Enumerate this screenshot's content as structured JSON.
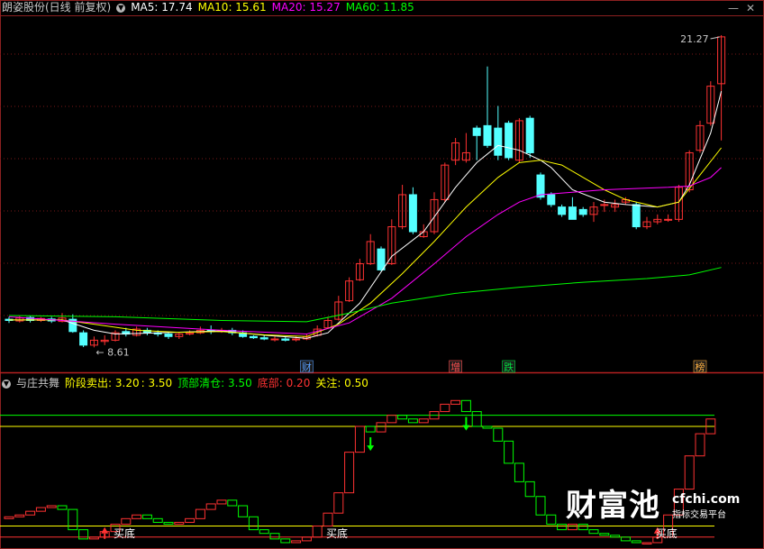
{
  "main_header": {
    "stock_name": "朗姿股份(日线 前复权)",
    "ma5": "MA5: 17.74",
    "ma10": "MA10: 15.61",
    "ma20": "MA20: 15.27",
    "ma60": "MA60: 11.85",
    "colors": {
      "name": "#c8c8c8",
      "ma5": "#ffffff",
      "ma10": "#ffff00",
      "ma20": "#ff00ff",
      "ma60": "#00ff00"
    }
  },
  "sub_header": {
    "indicator_name": "与庄共舞",
    "stage_sell": "阶段卖出: 3.20",
    "stage_sell2": ": 3.50",
    "top_clear": "顶部清仓: 3.50",
    "bottom": "底部: 0.20",
    "attention": "关注: 0.50",
    "colors": {
      "stage": "#ffff00",
      "top": "#00ff00",
      "bottom": "#ff3232",
      "attention": "#ffff00"
    }
  },
  "controls": {
    "toggle_icon": "chevron-down-icon",
    "window_minimize_icon": "minus-icon",
    "window_close_icon": "close-icon"
  },
  "chart_data": [
    {
      "type": "candlestick",
      "title": "朗姿股份(日线 前复权)",
      "price_annotations": {
        "high": "21.27",
        "low": "8.61"
      },
      "event_tags": [
        {
          "index": 28,
          "text": "财",
          "color": "#5aa0ff"
        },
        {
          "index": 42,
          "text": "增",
          "color": "#ff5050"
        },
        {
          "index": 47,
          "text": "跌",
          "color": "#00e040"
        },
        {
          "index": 65,
          "text": "榜",
          "color": "#ffb040"
        }
      ],
      "series": [
        {
          "name": "MA5",
          "color": "#ffffff"
        },
        {
          "name": "MA10",
          "color": "#ffff00"
        },
        {
          "name": "MA20",
          "color": "#ff00ff"
        },
        {
          "name": "MA60",
          "color": "#00ff00"
        }
      ],
      "ylim": [
        8.0,
        22.0
      ],
      "candles": [
        [
          9.75,
          9.7,
          9.85,
          9.6
        ],
        [
          9.68,
          9.8,
          9.88,
          9.62
        ],
        [
          9.82,
          9.7,
          9.9,
          9.62
        ],
        [
          9.7,
          9.78,
          9.84,
          9.64
        ],
        [
          9.76,
          9.68,
          9.85,
          9.6
        ],
        [
          9.66,
          9.8,
          10.0,
          9.62
        ],
        [
          9.75,
          9.25,
          9.95,
          9.2
        ],
        [
          9.2,
          8.7,
          9.3,
          8.62
        ],
        [
          8.7,
          8.9,
          9.05,
          8.61
        ],
        [
          8.85,
          8.9,
          9.1,
          8.7
        ],
        [
          8.9,
          9.2,
          9.3,
          8.85
        ],
        [
          9.25,
          9.15,
          9.4,
          9.05
        ],
        [
          9.1,
          9.35,
          9.45,
          9.05
        ],
        [
          9.3,
          9.2,
          9.4,
          9.1
        ],
        [
          9.2,
          9.15,
          9.3,
          9.05
        ],
        [
          9.15,
          9.05,
          9.25,
          8.95
        ],
        [
          9.05,
          9.15,
          9.2,
          8.95
        ],
        [
          9.15,
          9.2,
          9.3,
          9.1
        ],
        [
          9.2,
          9.3,
          9.45,
          9.15
        ],
        [
          9.3,
          9.25,
          9.5,
          9.15
        ],
        [
          9.25,
          9.3,
          9.4,
          9.2
        ],
        [
          9.3,
          9.2,
          9.4,
          9.1
        ],
        [
          9.2,
          9.05,
          9.3,
          9.0
        ],
        [
          9.05,
          9.0,
          9.1,
          8.95
        ],
        [
          9.0,
          8.95,
          9.1,
          8.9
        ],
        [
          8.95,
          8.95,
          9.05,
          8.85
        ],
        [
          8.95,
          8.9,
          9.05,
          8.85
        ],
        [
          8.95,
          8.95,
          9.05,
          8.85
        ],
        [
          8.95,
          9.05,
          9.15,
          8.9
        ],
        [
          9.1,
          9.35,
          9.5,
          9.05
        ],
        [
          9.4,
          9.7,
          9.85,
          9.35
        ],
        [
          9.75,
          10.45,
          10.7,
          9.7
        ],
        [
          10.5,
          11.3,
          11.45,
          10.45
        ],
        [
          11.35,
          12.0,
          12.2,
          11.3
        ],
        [
          12.0,
          12.9,
          13.2,
          11.95
        ],
        [
          12.6,
          11.75,
          12.7,
          11.7
        ],
        [
          12.0,
          13.5,
          13.8,
          11.95
        ],
        [
          13.5,
          14.8,
          15.2,
          13.4
        ],
        [
          14.8,
          13.3,
          15.1,
          13.2
        ],
        [
          13.1,
          13.3,
          13.6,
          13.05
        ],
        [
          13.3,
          14.6,
          14.9,
          13.2
        ],
        [
          14.6,
          16.0,
          16.1,
          14.5
        ],
        [
          16.2,
          16.9,
          17.1,
          16.0
        ],
        [
          16.2,
          16.5,
          17.3,
          16.1
        ],
        [
          17.5,
          17.2,
          17.6,
          16.2
        ],
        [
          17.6,
          16.8,
          20.0,
          16.7
        ],
        [
          17.5,
          16.4,
          18.4,
          16.2
        ],
        [
          17.7,
          16.3,
          17.8,
          16.2
        ],
        [
          16.2,
          17.8,
          17.9,
          16.1
        ],
        [
          17.9,
          16.5,
          18.0,
          16.3
        ],
        [
          15.6,
          14.7,
          15.7,
          14.6
        ],
        [
          14.8,
          14.4,
          14.9,
          14.3
        ],
        [
          14.3,
          14.0,
          14.4,
          13.9
        ],
        [
          14.3,
          13.8,
          14.7,
          13.8
        ],
        [
          14.2,
          14.0,
          14.3,
          13.9
        ],
        [
          14.0,
          14.3,
          14.5,
          13.7
        ],
        [
          14.4,
          14.4,
          14.6,
          14.1
        ],
        [
          14.3,
          14.4,
          14.6,
          14.1
        ],
        [
          14.5,
          14.6,
          14.7,
          14.4
        ],
        [
          14.4,
          13.5,
          14.5,
          13.4
        ],
        [
          13.5,
          13.7,
          13.9,
          13.4
        ],
        [
          13.7,
          13.8,
          14.0,
          13.6
        ],
        [
          13.8,
          13.8,
          14.0,
          13.7
        ],
        [
          13.8,
          15.1,
          15.2,
          13.7
        ],
        [
          15.0,
          16.5,
          16.6,
          14.9
        ],
        [
          16.6,
          17.6,
          17.8,
          16.5
        ],
        [
          17.7,
          19.2,
          19.4,
          17.6
        ],
        [
          19.3,
          21.2,
          21.27,
          17.0
        ]
      ],
      "ma": {
        "MA5": [
          [
            0,
            9.72
          ],
          [
            5,
            9.72
          ],
          [
            8,
            9.3
          ],
          [
            10,
            9.15
          ],
          [
            14,
            9.2
          ],
          [
            20,
            9.28
          ],
          [
            24,
            9.1
          ],
          [
            28,
            8.98
          ],
          [
            30,
            9.2
          ],
          [
            33,
            10.4
          ],
          [
            36,
            12.3
          ],
          [
            39,
            13.3
          ],
          [
            42,
            15.1
          ],
          [
            44,
            16.1
          ],
          [
            46,
            16.8
          ],
          [
            48,
            16.6
          ],
          [
            50,
            16.2
          ],
          [
            51,
            15.9
          ],
          [
            53,
            15.0
          ],
          [
            56,
            14.5
          ],
          [
            58,
            14.4
          ],
          [
            61,
            14.3
          ],
          [
            63,
            14.5
          ],
          [
            64,
            15.2
          ],
          [
            66,
            17.3
          ],
          [
            67,
            19.0
          ]
        ],
        "MA10": [
          [
            0,
            9.72
          ],
          [
            5,
            9.72
          ],
          [
            8,
            9.55
          ],
          [
            12,
            9.3
          ],
          [
            16,
            9.22
          ],
          [
            20,
            9.25
          ],
          [
            24,
            9.12
          ],
          [
            28,
            9.05
          ],
          [
            31,
            9.55
          ],
          [
            34,
            10.4
          ],
          [
            37,
            11.6
          ],
          [
            40,
            12.9
          ],
          [
            43,
            14.3
          ],
          [
            46,
            15.5
          ],
          [
            48,
            16.1
          ],
          [
            50,
            16.2
          ],
          [
            52,
            16.0
          ],
          [
            54,
            15.5
          ],
          [
            56,
            15.0
          ],
          [
            58,
            14.6
          ],
          [
            61,
            14.3
          ],
          [
            63,
            14.5
          ],
          [
            65,
            15.6
          ],
          [
            67,
            16.7
          ]
        ],
        "MA20": [
          [
            0,
            9.85
          ],
          [
            10,
            9.55
          ],
          [
            20,
            9.3
          ],
          [
            28,
            9.15
          ],
          [
            32,
            9.6
          ],
          [
            36,
            10.6
          ],
          [
            40,
            12.0
          ],
          [
            43,
            13.1
          ],
          [
            46,
            14.0
          ],
          [
            48,
            14.5
          ],
          [
            50,
            14.8
          ],
          [
            53,
            14.9
          ],
          [
            56,
            15.0
          ],
          [
            59,
            15.05
          ],
          [
            62,
            15.1
          ],
          [
            64,
            15.15
          ],
          [
            66,
            15.5
          ],
          [
            67,
            15.9
          ]
        ],
        "MA60": [
          [
            0,
            9.9
          ],
          [
            10,
            9.85
          ],
          [
            20,
            9.7
          ],
          [
            28,
            9.65
          ],
          [
            32,
            10.0
          ],
          [
            36,
            10.4
          ],
          [
            42,
            10.8
          ],
          [
            48,
            11.05
          ],
          [
            54,
            11.25
          ],
          [
            60,
            11.4
          ],
          [
            64,
            11.55
          ],
          [
            67,
            11.85
          ]
        ]
      }
    },
    {
      "type": "bar",
      "title": "与庄共舞",
      "ylim": [
        0.0,
        4.2
      ],
      "reference_lines": [
        {
          "name": "阶段卖出",
          "value": 3.2,
          "color": "#ffff00"
        },
        {
          "name": "顶部清仓",
          "value": 3.5,
          "color": "#00ff00"
        },
        {
          "name": "关注",
          "value": 0.5,
          "color": "#ffff00"
        },
        {
          "name": "底部",
          "value": 0.2,
          "color": "#ff3232"
        }
      ],
      "labels": [
        {
          "index": 10,
          "text": "买底"
        },
        {
          "index": 30,
          "text": "买底"
        },
        {
          "index": 61,
          "text": "买底"
        }
      ],
      "down_arrows": [
        34,
        43
      ],
      "up_arrows": [
        9,
        61
      ],
      "step_bars": [
        [
          0.7,
          0.75
        ],
        [
          0.75,
          0.8
        ],
        [
          0.8,
          0.9
        ],
        [
          0.9,
          1.0
        ],
        [
          1.0,
          1.05
        ],
        [
          1.05,
          0.95
        ],
        [
          0.95,
          0.4
        ],
        [
          0.4,
          0.15
        ],
        [
          0.15,
          0.2
        ],
        [
          0.2,
          0.35
        ],
        [
          0.35,
          0.55
        ],
        [
          0.55,
          0.7
        ],
        [
          0.7,
          0.8
        ],
        [
          0.8,
          0.7
        ],
        [
          0.7,
          0.6
        ],
        [
          0.6,
          0.55
        ],
        [
          0.55,
          0.6
        ],
        [
          0.6,
          0.7
        ],
        [
          0.7,
          0.95
        ],
        [
          0.95,
          1.1
        ],
        [
          1.1,
          1.2
        ],
        [
          1.2,
          1.05
        ],
        [
          1.05,
          0.75
        ],
        [
          0.75,
          0.4
        ],
        [
          0.4,
          0.3
        ],
        [
          0.3,
          0.15
        ],
        [
          0.15,
          0.05
        ],
        [
          0.05,
          0.1
        ],
        [
          0.1,
          0.2
        ],
        [
          0.2,
          0.5
        ],
        [
          0.5,
          0.85
        ],
        [
          0.85,
          1.4
        ],
        [
          1.4,
          2.5
        ],
        [
          2.5,
          3.2
        ],
        [
          3.2,
          3.05
        ],
        [
          3.05,
          3.3
        ],
        [
          3.3,
          3.5
        ],
        [
          3.5,
          3.4
        ],
        [
          3.4,
          3.3
        ],
        [
          3.3,
          3.4
        ],
        [
          3.4,
          3.6
        ],
        [
          3.6,
          3.8
        ],
        [
          3.8,
          3.9
        ],
        [
          3.9,
          3.6
        ],
        [
          3.6,
          3.2
        ],
        [
          3.2,
          3.15
        ],
        [
          3.15,
          2.8
        ],
        [
          2.8,
          2.2
        ],
        [
          2.2,
          1.7
        ],
        [
          1.7,
          1.3
        ],
        [
          1.3,
          0.8
        ],
        [
          0.8,
          0.55
        ],
        [
          0.55,
          0.4
        ],
        [
          0.4,
          0.55
        ],
        [
          0.55,
          0.4
        ],
        [
          0.4,
          0.3
        ],
        [
          0.3,
          0.25
        ],
        [
          0.25,
          0.2
        ],
        [
          0.2,
          0.1
        ],
        [
          0.1,
          0.05
        ],
        [
          0.05,
          0.05
        ],
        [
          0.05,
          0.2
        ],
        [
          0.2,
          0.8
        ],
        [
          0.8,
          1.5
        ],
        [
          1.5,
          2.4
        ],
        [
          2.4,
          3.0
        ],
        [
          3.0,
          3.4
        ]
      ]
    }
  ],
  "watermark": {
    "logo": "财富池",
    "site": "cfchi.com",
    "tagline": "指标交易平台"
  }
}
